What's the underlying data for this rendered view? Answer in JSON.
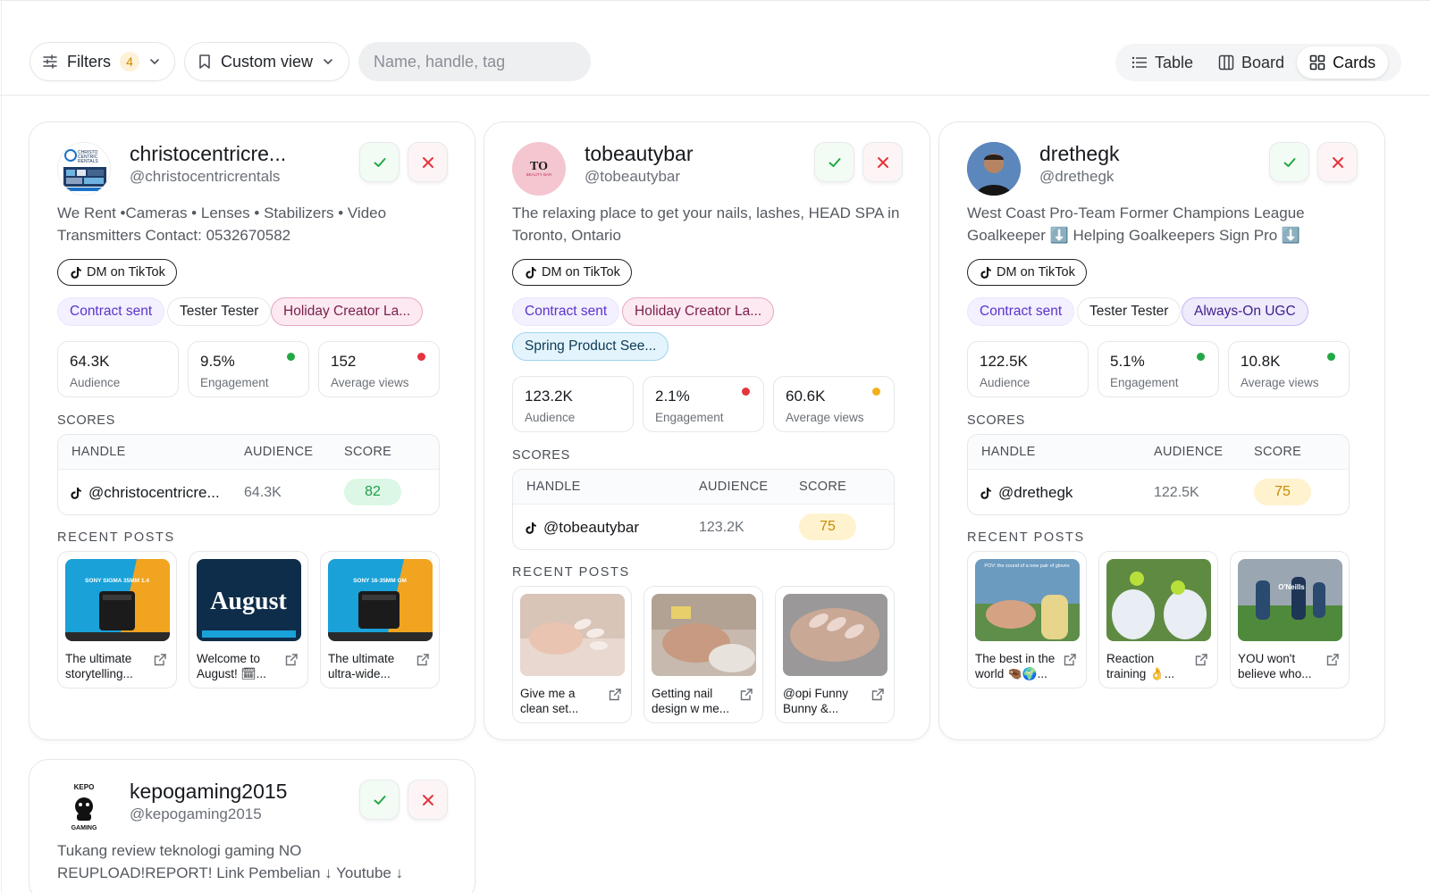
{
  "toolbar": {
    "filters_label": "Filters",
    "filters_count": "4",
    "view_label": "Custom view",
    "search_placeholder": "Name, handle, tag",
    "views": [
      "Table",
      "Board",
      "Cards"
    ],
    "active_view": "Cards"
  },
  "labels": {
    "dm": "DM on TikTok",
    "scores": "SCORES",
    "recent_posts": "RECENT POSTS",
    "col_handle": "HANDLE",
    "col_audience": "AUDIENCE",
    "col_score": "SCORE",
    "audience": "Audience",
    "engagement": "Engagement",
    "avg_views": "Average views"
  },
  "colors": {
    "dot_green": "#22a845",
    "dot_red": "#e5343d",
    "dot_yellow": "#f2b01e",
    "approve": "#22a845",
    "reject": "#e5343d"
  },
  "creators": [
    {
      "name": "christocentricre...",
      "handle": "@christocentricrentals",
      "bio": "We Rent •Cameras • Lenses • Stabilizers • Video Transmitters Contact: 0532670582",
      "tags": [
        "Contract sent",
        "Tester Tester",
        "Holiday Creator La..."
      ],
      "metrics": {
        "audience": "64.3K",
        "engagement": "9.5%",
        "avg_views": "152"
      },
      "dots": {
        "engagement": "green",
        "avg_views": "red"
      },
      "score_row": {
        "handle": "@christocentricre...",
        "audience": "64.3K",
        "score": "82",
        "level": "green"
      },
      "posts": [
        {
          "title": "The ultimate storytelling...",
          "thumb_text": "SONY SIGMA 35MM 1.4"
        },
        {
          "title": "Welcome to August! 🗓...",
          "thumb_text": "August"
        },
        {
          "title": "The ultimate ultra-wide...",
          "thumb_text": "SONY 16-35MM GM"
        }
      ]
    },
    {
      "name": "tobeautybar",
      "handle": "@tobeautybar",
      "bio": "The relaxing place to get your nails, lashes, HEAD SPA in Toronto, Ontario",
      "tags": [
        "Contract sent",
        "Holiday Creator La...",
        "Spring Product See..."
      ],
      "metrics": {
        "audience": "123.2K",
        "engagement": "2.1%",
        "avg_views": "60.6K"
      },
      "dots": {
        "engagement": "red",
        "avg_views": "yellow"
      },
      "score_row": {
        "handle": "@tobeautybar",
        "audience": "123.2K",
        "score": "75",
        "level": "yellow"
      },
      "posts": [
        {
          "title": "Give me a clean set...",
          "thumb_text": ""
        },
        {
          "title": "Getting nail design w me...",
          "thumb_text": ""
        },
        {
          "title": "@opi Funny Bunny &...",
          "thumb_text": ""
        }
      ]
    },
    {
      "name": "drethegk",
      "handle": "@drethegk",
      "bio": "West Coast Pro-Team Former Champions League Goalkeeper ⬇️ Helping Goalkeepers Sign Pro ⬇️",
      "tags": [
        "Contract sent",
        "Tester Tester",
        "Always-On UGC"
      ],
      "metrics": {
        "audience": "122.5K",
        "engagement": "5.1%",
        "avg_views": "10.8K"
      },
      "dots": {
        "engagement": "green",
        "avg_views": "green"
      },
      "score_row": {
        "handle": "@drethegk",
        "audience": "122.5K",
        "score": "75",
        "level": "yellow"
      },
      "posts": [
        {
          "title": "The best in the world 🤏🏾🌍...",
          "thumb_text": "POV: the sound of a new pair of gloves"
        },
        {
          "title": "Reaction training 👌...",
          "thumb_text": ""
        },
        {
          "title": "YOU won't believe who...",
          "thumb_text": "O'Neills"
        }
      ]
    },
    {
      "name": "kepogaming2015",
      "handle": "@kepogaming2015",
      "bio": "Tukang review teknologi gaming NO REUPLOAD!REPORT! Link Pembelian ↓ Youtube ↓",
      "logo_text": [
        "KEPO",
        "GAMING"
      ]
    }
  ],
  "avatar_text": {
    "c1": [
      "CHRISTO",
      "CENTRIC",
      "RENTALS"
    ],
    "c2_main": "TO",
    "c2_sub": "BEAUTY BAR"
  }
}
